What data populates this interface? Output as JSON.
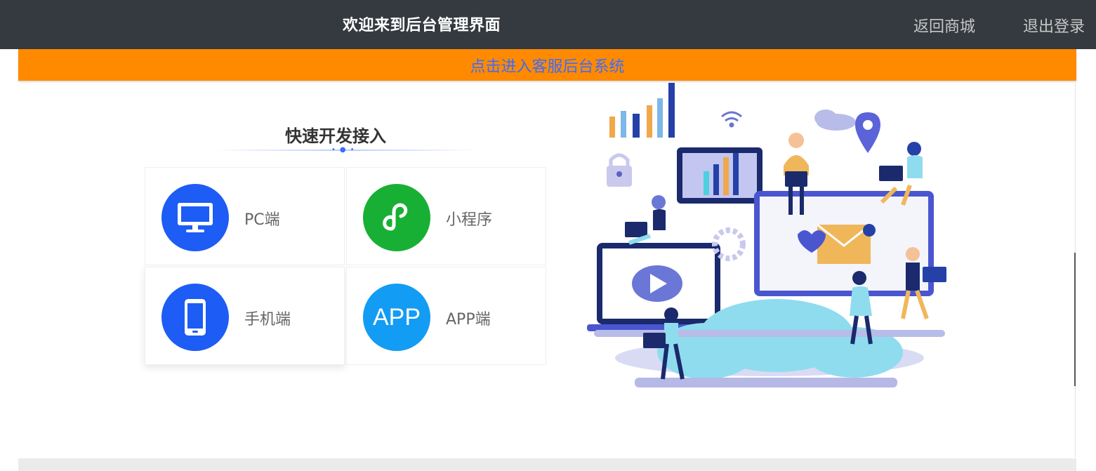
{
  "header": {
    "title": "欢迎来到后台管理界面",
    "back_to_mall": "返回商城",
    "logout": "退出登录"
  },
  "cs_bar": {
    "link": "点击进入客服后台系统"
  },
  "panel": {
    "title": "快速开发接入",
    "items": [
      {
        "label": "PC端",
        "icon": "monitor-icon",
        "color": "#1d5cf5"
      },
      {
        "label": "小程序",
        "icon": "mini-program-icon",
        "color": "#17b035"
      },
      {
        "label": "手机端",
        "icon": "phone-icon",
        "color": "#1d5cf5"
      },
      {
        "label": "APP端",
        "icon": "app-icon",
        "icon_text": "APP",
        "color": "#139cf3"
      }
    ]
  },
  "colors": {
    "header_bg": "#353a40",
    "cs_bar_bg": "#ff8a00",
    "link_blue": "#3b6cff"
  }
}
